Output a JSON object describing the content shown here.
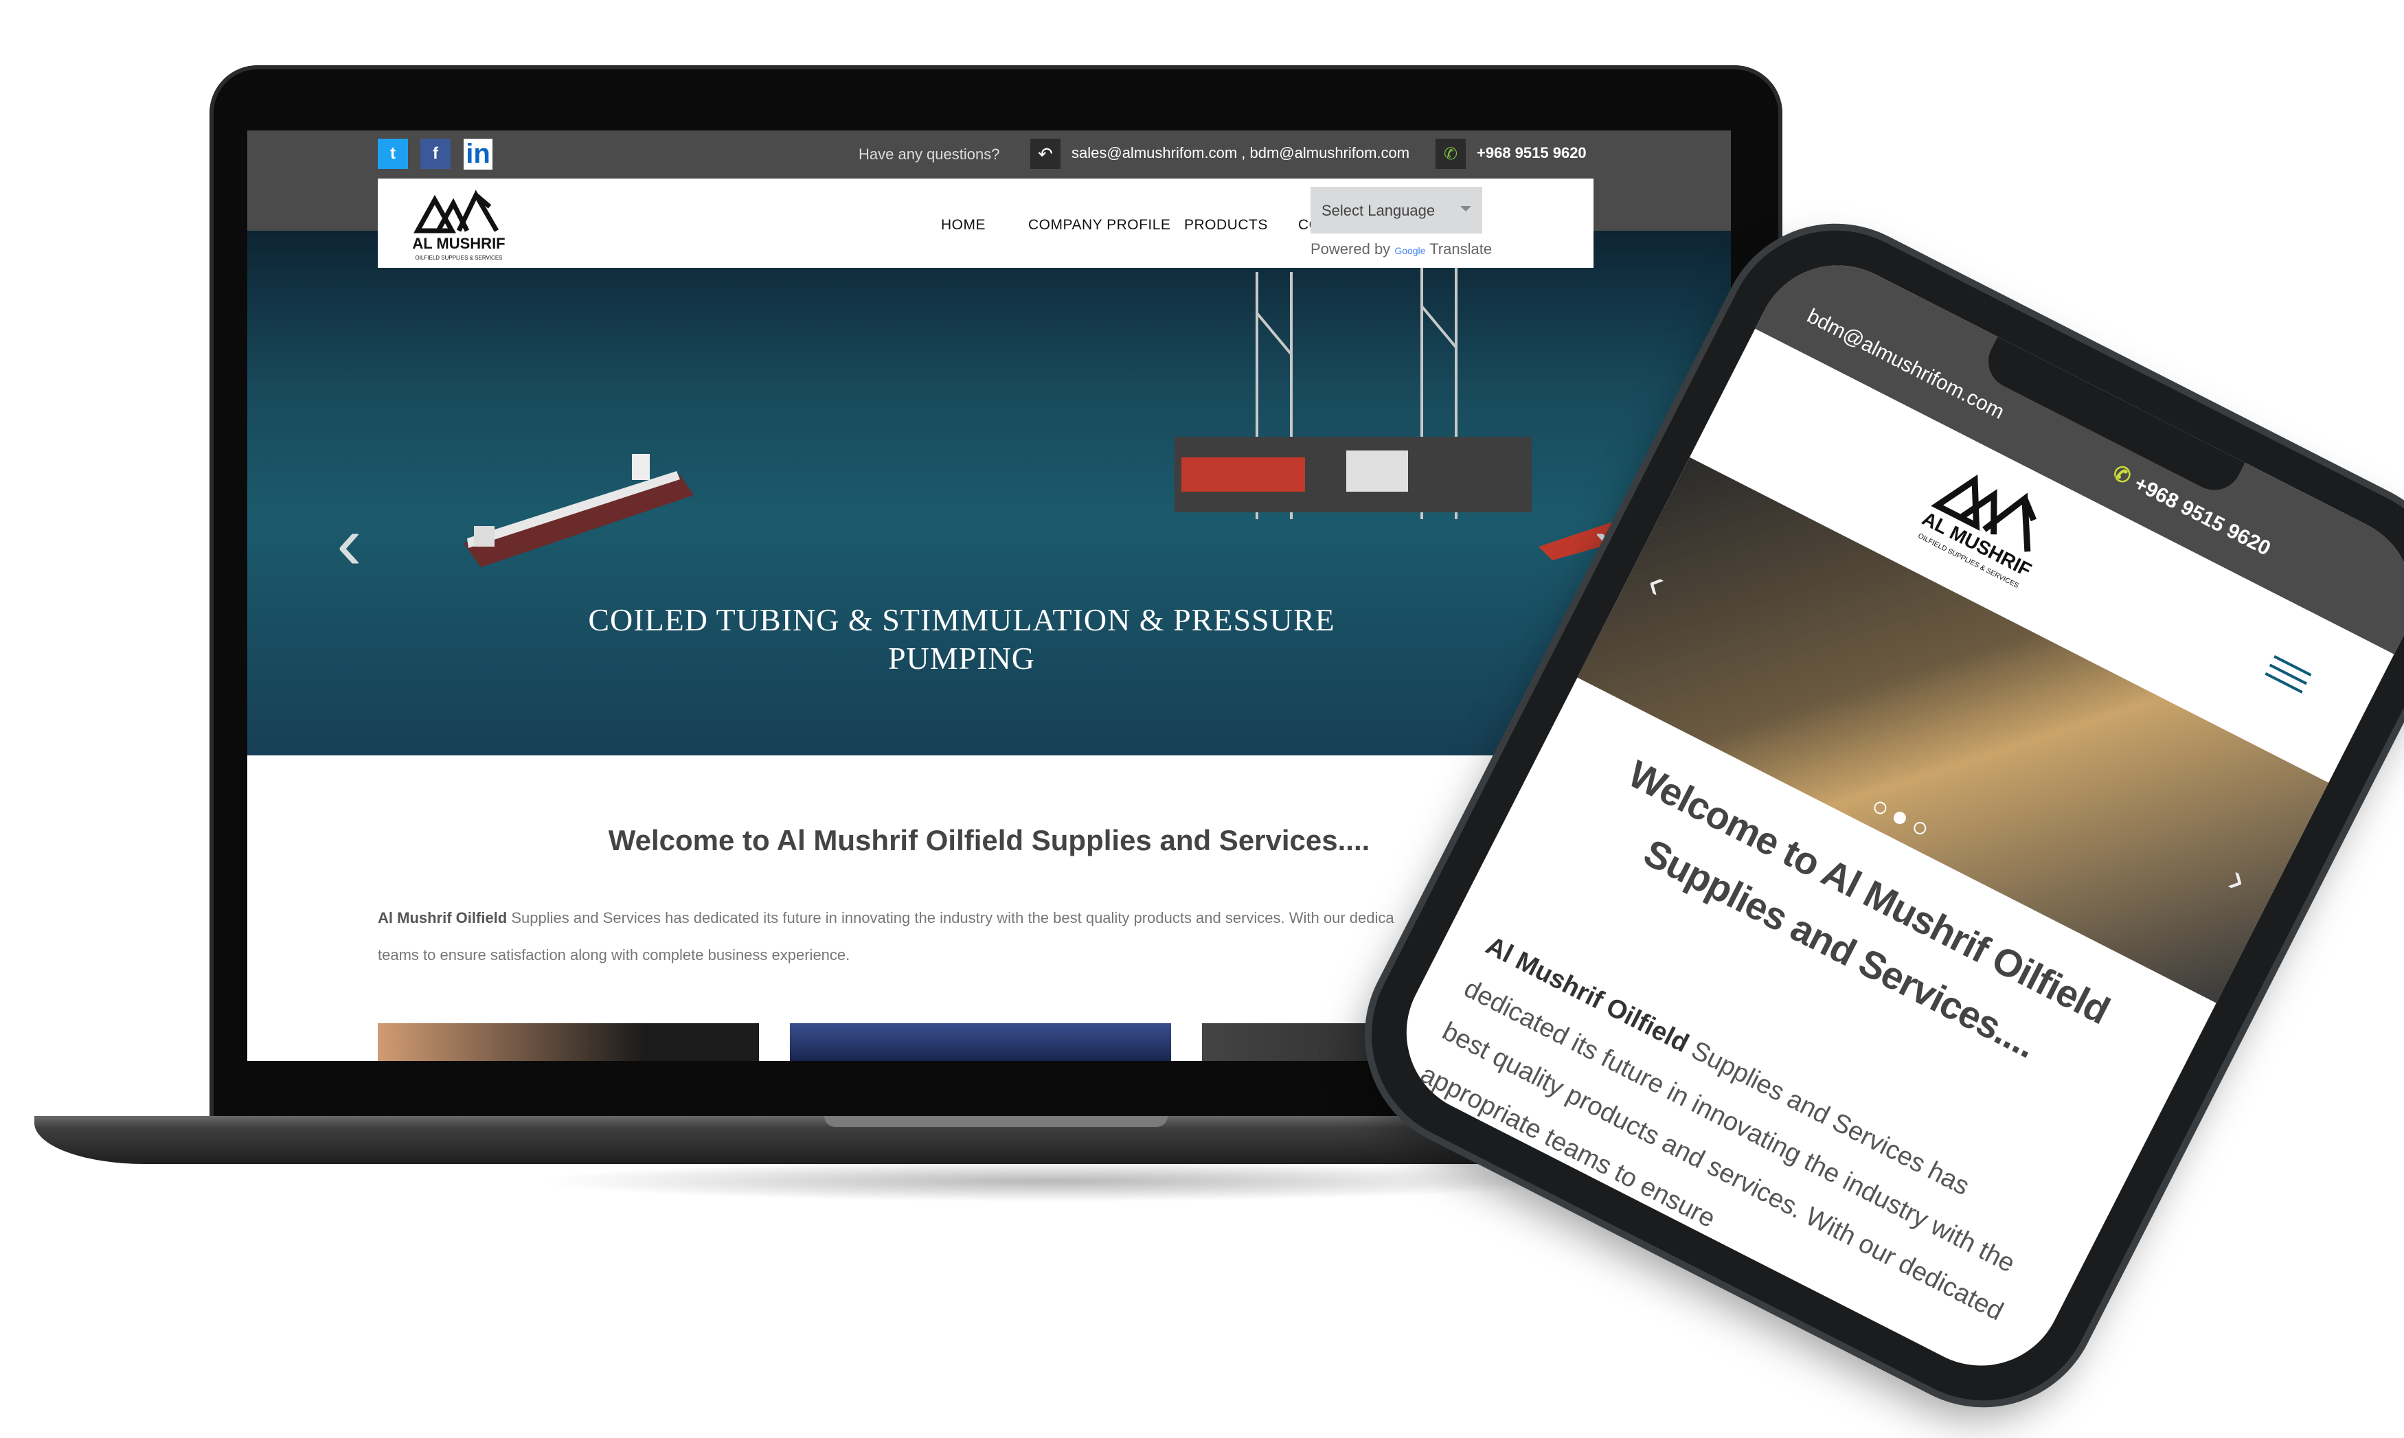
{
  "laptop": {
    "topbar": {
      "question": "Have any questions?",
      "emails": "sales@almushrifom.com , bdm@almushrifom.com",
      "phone": "+968 9515 9620",
      "social": [
        {
          "name": "twitter",
          "glyph": "t"
        },
        {
          "name": "facebook",
          "glyph": "f"
        },
        {
          "name": "linkedin",
          "glyph": "in"
        }
      ]
    },
    "header": {
      "logo_text": "AL MUSHRIF",
      "logo_subtext": "OILFIELD SUPPLIES & SERVICES",
      "nav": [
        "HOME",
        "COMPANY PROFILE",
        "PRODUCTS",
        "CONTACT"
      ],
      "language_select": "Select Language",
      "powered_by": "Powered by",
      "google": "Google",
      "translate": "Translate"
    },
    "hero": {
      "title": "COILED TUBING & STIMMULATION & PRESSURE PUMPING",
      "prev_icon": "chevron-left-icon",
      "next_icon": "chevron-right-icon"
    },
    "content": {
      "welcome": "Welcome to Al Mushrif Oilfield Supplies and Services....",
      "para_bold": "Al Mushrif Oilfield",
      "para_rest": " Supplies and Services has dedicated its future in innovating the industry with the best quality products and services. With our dedica",
      "para_line2": "teams to ensure satisfaction along with complete business experience."
    }
  },
  "phone": {
    "topbar": {
      "email": "bdm@almushrifom.com",
      "phone": "+968 9515 9620"
    },
    "header": {
      "logo_text": "AL MUSHRIF",
      "logo_subtext": "OILFIELD SUPPLIES & SERVICES"
    },
    "welcome": "Welcome to Al Mushrif Oilfield Supplies and Services....",
    "para_bold": "Al Mushrif Oilfield",
    "para_rest": " Supplies and Services has dedicated its future in innovating the industry with the best quality products and services. With our dedicated appropriate teams to ensure"
  },
  "colors": {
    "topbar_bg": "#4b4b4b",
    "twitter": "#1da1f2",
    "facebook": "#3b5998",
    "linkedin": "#0a66c2",
    "phone_icon": "#7cc242",
    "menu_accent": "#0f5b7a"
  }
}
